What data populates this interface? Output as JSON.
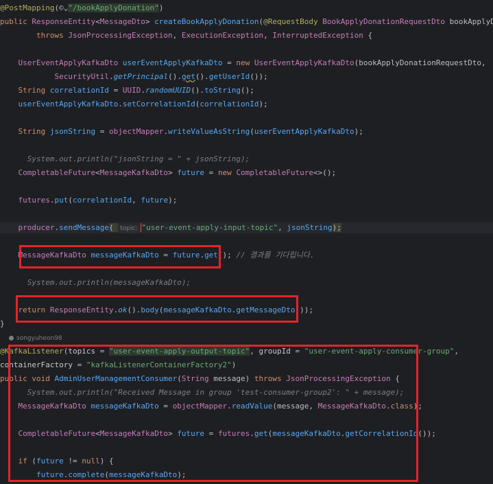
{
  "code": {
    "l1": {
      "ann": "@PostMapping",
      "mid": "(",
      "icons": "©⌄",
      "path": "\"/bookApplyDonation\"",
      "end": ")"
    },
    "l2": {
      "a": "public ",
      "b": "ResponseEntity",
      "c": "<",
      "d": "MessageDto",
      "e": "> ",
      "f": "createBookApplyDonation",
      "g": "(",
      "h": "@RequestBody ",
      "i": "BookApplyDonationRequestDto ",
      "j": "bookApplyDonationRe"
    },
    "l3": {
      "a": "        throws ",
      "b": "JsonProcessingException",
      "c": ", ",
      "d": "ExecutionException",
      "e": ", ",
      "f": "InterruptedException",
      "g": " {"
    },
    "l4": {
      "a": "    ",
      "b": "UserEventApplyKafkaDto ",
      "c": "userEventApplyKafkaDto",
      "d": " = ",
      "e": "new ",
      "f": "UserEventApplyKafkaDto",
      "g": "(bookApplyDonationRequestDto,"
    },
    "l5": {
      "a": "            ",
      "b": "SecurityUtil",
      "c": ".",
      "d": "getPrincipal",
      "e": "().",
      "f": "get",
      "g": "().",
      "h": "getUserId",
      "i": "());"
    },
    "l6": {
      "a": "    ",
      "b": "String ",
      "c": "correlationId",
      "d": " = ",
      "e": "UUID",
      "f": ".",
      "g": "randomUUID",
      "h": "().",
      "i": "toString",
      "j": "();"
    },
    "l7": {
      "a": "    ",
      "b": "userEventApplyKafkaDto",
      "c": ".",
      "d": "setCorrelationId",
      "e": "(",
      "f": "correlationId",
      "g": ");"
    },
    "l8": {
      "a": "    ",
      "b": "String ",
      "c": "jsonString",
      "d": " = ",
      "e": "objectMapper",
      "f": ".",
      "g": "writeValueAsString",
      "h": "(",
      "i": "userEventApplyKafkaDto",
      "j": ");"
    },
    "l9": {
      "a": "      ",
      "b": "System.out.println(\"jsonString = \" + jsonString);"
    },
    "l10": {
      "a": "    ",
      "b": "CompletableFuture",
      "c": "<",
      "d": "MessageKafkaDto",
      "e": "> ",
      "f": "future",
      "g": " = ",
      "h": "new ",
      "i": "CompletableFuture",
      "j": "<>();"
    },
    "l11": {
      "a": "    ",
      "b": "futures",
      "c": ".",
      "d": "put",
      "e": "(",
      "f": "correlationId",
      "g": ", ",
      "h": "future",
      "i": ");"
    },
    "l12": {
      "a": "    ",
      "b": "producer",
      "c": ".",
      "d": "sendMessage",
      "e": "( ",
      "hint": "topic:",
      "f": "\"user-event-apply-input-topic\"",
      "g": ", ",
      "h": "jsonString",
      "i": ");"
    },
    "l13": {
      "a": "    ",
      "b": "MessageKafkaDto ",
      "c": "messageKafkaDto",
      "d": " = ",
      "e": "future",
      "f": ".",
      "g": "get",
      "h": "(); ",
      "i": "// 결과를 기다립니다."
    },
    "l14": {
      "a": "      ",
      "b": "System.out.println(messageKafkaDto);"
    },
    "l15": {
      "a": "    ",
      "b": "return ",
      "c": "ResponseEntity",
      "d": ".",
      "e": "ok",
      "f": "().",
      "g": "body",
      "h": "(",
      "i": "messageKafkaDto",
      "j": ".",
      "k": "getMessageDto",
      "l": "());"
    },
    "l16": {
      "a": "}"
    },
    "author": "songyuheon98",
    "l17": {
      "a": "@KafkaListener",
      "b": "(",
      "c": "topics",
      "d": " = ",
      "e": "\"user-event-apply-output-topic\"",
      "f": ", ",
      "g": "groupId",
      "h": " = ",
      "i": "\"user-event-apply-consumer-group\"",
      "j": ","
    },
    "l18": {
      "a": "containerFactory",
      "b": " = ",
      "c": "\"kafkaListenerContainerFactory2\"",
      "d": ")"
    },
    "l19": {
      "a": "public ",
      "b": "void ",
      "c": "AdminUserManagementConsumer",
      "d": "(",
      "e": "String ",
      "f": "message",
      "g": ") ",
      "h": "throws ",
      "i": "JsonProcessingException",
      "j": " {"
    },
    "l20": {
      "a": "      ",
      "b": "System.out.println(\"Received Message in group 'test-consumer-group2': \" + message);"
    },
    "l21": {
      "a": "    ",
      "b": "MessageKafkaDto ",
      "c": "messageKafkaDto",
      "d": " = ",
      "e": "objectMapper",
      "f": ".",
      "g": "readValue",
      "h": "(message, ",
      "i": "MessageKafkaDto",
      "j": ".",
      "k": "class",
      "l": ");"
    },
    "l22": {
      "a": "    ",
      "b": "CompletableFuture",
      "c": "<",
      "d": "MessageKafkaDto",
      "e": "> ",
      "f": "future",
      "g": " = ",
      "h": "futures",
      "i": ".",
      "j": "get",
      "k": "(",
      "l": "messageKafkaDto",
      "m": ".",
      "n": "getCorrelationId",
      "o": "());"
    },
    "l23": {
      "a": "    ",
      "b": "if ",
      "c": "(",
      "d": "future",
      "e": " != ",
      "f": "null",
      "g": ") {"
    },
    "l24": {
      "a": "        ",
      "b": "future",
      "c": ".",
      "d": "complete",
      "e": "(",
      "f": "messageKafkaDto",
      "g": ");"
    }
  }
}
